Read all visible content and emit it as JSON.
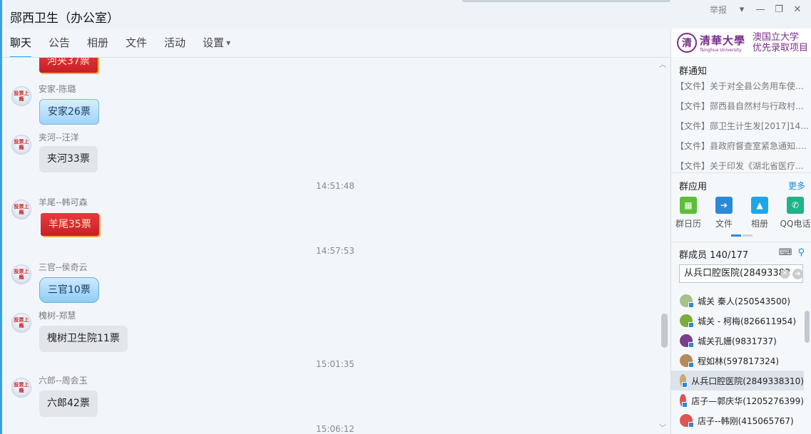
{
  "window": {
    "title": "郧西卫生（办公室）",
    "report_label": "举报",
    "controls": [
      "dropdown",
      "minimize",
      "restore",
      "close"
    ]
  },
  "tabs": [
    {
      "label": "聊天",
      "active": true
    },
    {
      "label": "公告"
    },
    {
      "label": "相册"
    },
    {
      "label": "文件"
    },
    {
      "label": "活动"
    },
    {
      "label": "设置"
    }
  ],
  "chat": {
    "avatar_text": "投票上瘾",
    "messages": [
      {
        "sender": "",
        "text": "河夹37票",
        "style": "red"
      },
      {
        "sender": "安家-陈璐",
        "text": "安家26票",
        "style": "blue"
      },
      {
        "sender": "夹河--汪洋",
        "text": "夹河33票",
        "style": "plain"
      },
      {
        "timestamp": "14:51:48"
      },
      {
        "sender": "羊尾--韩可森",
        "text": "羊尾35票",
        "style": "red"
      },
      {
        "timestamp": "14:57:53"
      },
      {
        "sender": "三官--侯奇云",
        "text": "三官10票",
        "style": "blue2"
      },
      {
        "sender": "槐树-郑慧",
        "text": "槐树卫生院11票",
        "style": "plain"
      },
      {
        "timestamp": "15:01:35"
      },
      {
        "sender": "六郎--周会玉",
        "text": "六郎42票",
        "style": "plain"
      },
      {
        "timestamp": "15:06:12"
      }
    ]
  },
  "sidebar": {
    "ad": {
      "university_cn": "清華大學",
      "university_en": "Tsinghua University",
      "promo_line1": "澳国立大学",
      "promo_line2": "优先录取项目"
    },
    "notice": {
      "title": "群通知",
      "items": [
        "【文件】关于对全县公务用车使用...",
        "【文件】郧西县自然村与行政村合...",
        "【文件】郧卫生计生发[2017]14号 ...",
        "【文件】县政府督查室紧急通知.doc",
        "【文件】关于印发《湖北省医疗卫..."
      ]
    },
    "apps": {
      "title": "群应用",
      "more": "更多",
      "items": [
        {
          "label": "群日历",
          "icon": "calendar-icon",
          "color": "#5cbf3a"
        },
        {
          "label": "文件",
          "icon": "folder-icon",
          "color": "#2a8ad8"
        },
        {
          "label": "相册",
          "icon": "photo-icon",
          "color": "#1ea7e8"
        },
        {
          "label": "QQ电话",
          "icon": "phone-icon",
          "color": "#1fb389"
        }
      ]
    },
    "members": {
      "title": "群成员 140/177",
      "search_value": "从兵口腔医院(28493383",
      "list": [
        {
          "name": "城关 秦人(250543500)",
          "color": "#a8c08a"
        },
        {
          "name": "城关 - 柯梅(826611954)",
          "color": "#7dab3c"
        },
        {
          "name": "城关孔姗(9831737)",
          "color": "#7a3f8a"
        },
        {
          "name": "程如林(597817324)",
          "color": "#b58b5a"
        },
        {
          "name": "从兵口腔医院(2849338310)",
          "color": "#c8a878",
          "selected": true
        },
        {
          "name": "店子—郭庆华(1205276399)",
          "color": "#d55"
        },
        {
          "name": "店子--韩刚(415065767)",
          "color": "#d55"
        }
      ]
    }
  }
}
